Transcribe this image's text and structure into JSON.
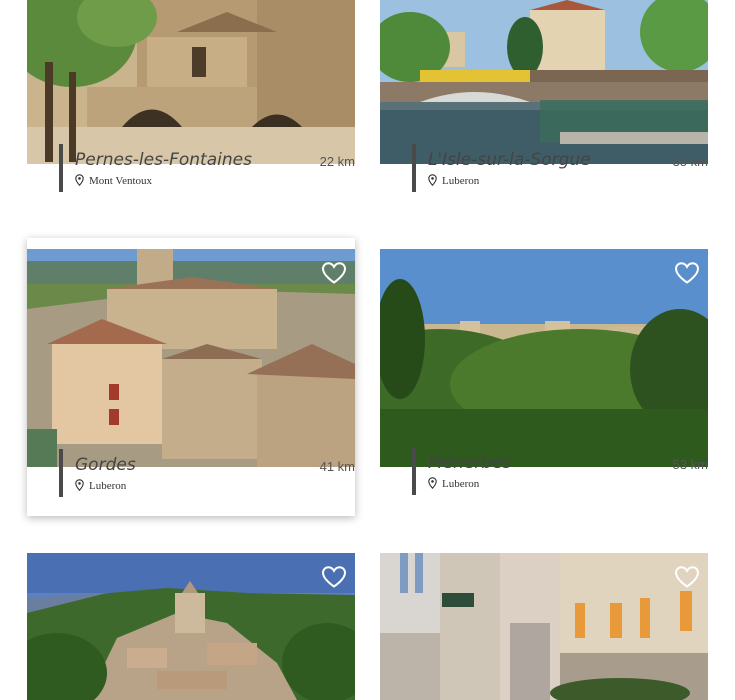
{
  "cards": [
    {
      "name": "Pernes-les-Fontaines",
      "distance": "22 km",
      "location": "Mont Ventoux",
      "photo_icon": "town-photo",
      "favorite_icon": "heart-outline-icon"
    },
    {
      "name": "L'Isle-sur-la-Sorgue",
      "distance": "35 km",
      "location": "Luberon",
      "photo_icon": "river-photo",
      "favorite_icon": "heart-outline-icon"
    },
    {
      "name": "Gordes",
      "distance": "41 km",
      "location": "Luberon",
      "photo_icon": "village-photo",
      "favorite_icon": "heart-outline-icon"
    },
    {
      "name": "Ménerbes",
      "distance": "53 km",
      "location": "Luberon",
      "photo_icon": "hilltop-photo",
      "favorite_icon": "heart-outline-icon"
    },
    {
      "name": "",
      "distance": "",
      "location": "",
      "photo_icon": "hill-village-photo",
      "favorite_icon": "heart-outline-icon"
    },
    {
      "name": "",
      "distance": "",
      "location": "",
      "photo_icon": "street-photo",
      "favorite_icon": "heart-outline-icon"
    }
  ],
  "colors": {
    "accent_bar": "#4a4a4a",
    "heart": "#ffffff"
  }
}
